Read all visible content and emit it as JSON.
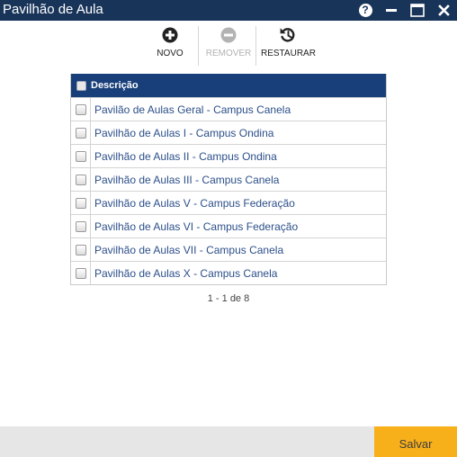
{
  "window": {
    "title": "Pavilhão de Aula",
    "help_label": "?"
  },
  "toolbar": {
    "novo_label": "NOVO",
    "remover_label": "REMOVER",
    "restaurar_label": "RESTAURAR"
  },
  "grid": {
    "header_label": "Descrição",
    "rows": [
      "Pavilão de Aulas Geral - Campus Canela",
      "Pavilhão de Aulas I - Campus Ondina",
      "Pavilhão de Aulas II - Campus Ondina",
      "Pavilhão de Aulas III - Campus Canela",
      "Pavilhão de Aulas V - Campus Federação",
      "Pavilhão de Aulas VI - Campus Federação",
      "Pavilhão de Aulas VII - Campus Canela",
      "Pavilhão de Aulas X - Campus Canela"
    ]
  },
  "pager": {
    "text": "1 - 1 de 8"
  },
  "footer": {
    "save_label": "Salvar"
  },
  "colors": {
    "titlebar": "#183459",
    "grid_header": "#183f7a",
    "row_text": "#2c4f8a",
    "save_button": "#f8b01a"
  }
}
